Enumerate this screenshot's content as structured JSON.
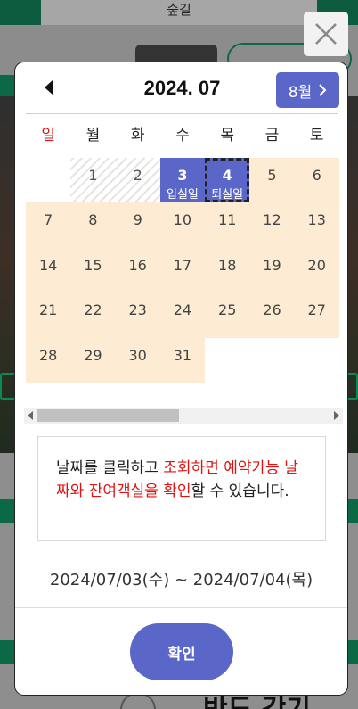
{
  "background": {
    "top_title": "숲길",
    "bottom_text": "반도 갓기"
  },
  "calendar": {
    "title": "2024. 07",
    "next_label": "8월",
    "weekdays": [
      "일",
      "월",
      "화",
      "수",
      "목",
      "금",
      "토"
    ],
    "weeks": [
      [
        {
          "day": "",
          "state": "empty"
        },
        {
          "day": "1",
          "state": "past"
        },
        {
          "day": "2",
          "state": "past"
        },
        {
          "day": "3",
          "state": "checkin",
          "sub": "입실일"
        },
        {
          "day": "4",
          "state": "checkout",
          "sub": "퇴실일"
        },
        {
          "day": "5",
          "state": "available"
        },
        {
          "day": "6",
          "state": "available"
        }
      ],
      [
        {
          "day": "7",
          "state": "available"
        },
        {
          "day": "8",
          "state": "available"
        },
        {
          "day": "9",
          "state": "available"
        },
        {
          "day": "10",
          "state": "available"
        },
        {
          "day": "11",
          "state": "available"
        },
        {
          "day": "12",
          "state": "available"
        },
        {
          "day": "13",
          "state": "available"
        }
      ],
      [
        {
          "day": "14",
          "state": "available"
        },
        {
          "day": "15",
          "state": "available"
        },
        {
          "day": "16",
          "state": "available"
        },
        {
          "day": "17",
          "state": "available"
        },
        {
          "day": "18",
          "state": "available"
        },
        {
          "day": "19",
          "state": "available"
        },
        {
          "day": "20",
          "state": "available"
        }
      ],
      [
        {
          "day": "21",
          "state": "available"
        },
        {
          "day": "22",
          "state": "available"
        },
        {
          "day": "23",
          "state": "available"
        },
        {
          "day": "24",
          "state": "available"
        },
        {
          "day": "25",
          "state": "available"
        },
        {
          "day": "26",
          "state": "available"
        },
        {
          "day": "27",
          "state": "available"
        }
      ],
      [
        {
          "day": "28",
          "state": "available"
        },
        {
          "day": "29",
          "state": "available"
        },
        {
          "day": "30",
          "state": "available"
        },
        {
          "day": "31",
          "state": "available"
        },
        {
          "day": "",
          "state": "empty"
        },
        {
          "day": "",
          "state": "empty"
        },
        {
          "day": "",
          "state": "empty"
        }
      ]
    ]
  },
  "info": {
    "part1": "날짜를 클릭하고 ",
    "highlight": "조회하면 예약가능 날짜와 잔여객실을 확인",
    "part2": "할 수 있습니다."
  },
  "selected_range": "2024/07/03(수) ~ 2024/07/04(목)",
  "confirm_label": "확인",
  "colors": {
    "accent": "#5a67c8",
    "available": "#fdebd3",
    "sunday": "#d01c1c",
    "highlight_text": "#e01212"
  }
}
